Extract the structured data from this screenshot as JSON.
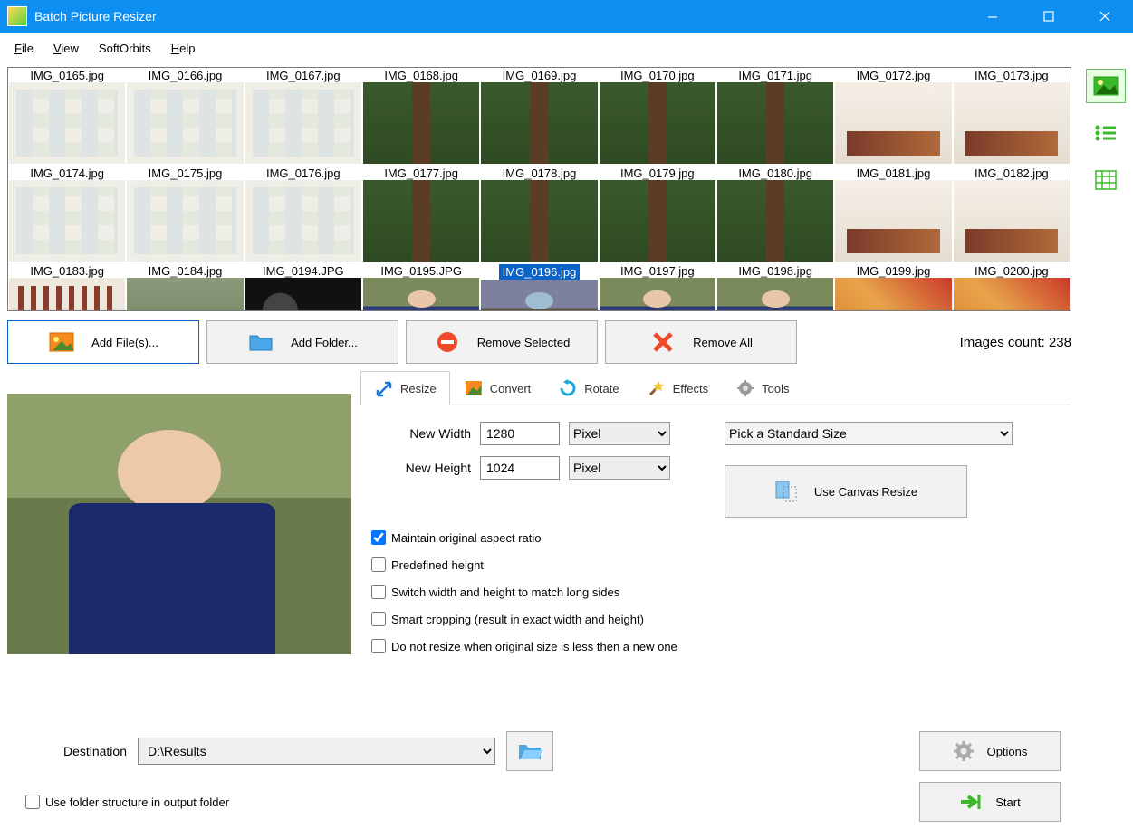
{
  "app": {
    "title": "Batch Picture Resizer"
  },
  "menu": {
    "file": "File",
    "view": "View",
    "softorbits": "SoftOrbits",
    "help": "Help"
  },
  "thumbs": [
    {
      "fn": "IMG_0165.jpg",
      "cls": "t-board"
    },
    {
      "fn": "IMG_0166.jpg",
      "cls": "t-board"
    },
    {
      "fn": "IMG_0167.jpg",
      "cls": "t-board"
    },
    {
      "fn": "IMG_0168.jpg",
      "cls": "t-tree"
    },
    {
      "fn": "IMG_0169.jpg",
      "cls": "t-tree"
    },
    {
      "fn": "IMG_0170.jpg",
      "cls": "t-tree"
    },
    {
      "fn": "IMG_0171.jpg",
      "cls": "t-tree"
    },
    {
      "fn": "IMG_0172.jpg",
      "cls": "t-room"
    },
    {
      "fn": "IMG_0173.jpg",
      "cls": "t-room"
    },
    {
      "fn": "IMG_0174.jpg",
      "cls": "t-board"
    },
    {
      "fn": "IMG_0175.jpg",
      "cls": "t-board"
    },
    {
      "fn": "IMG_0176.jpg",
      "cls": "t-board"
    },
    {
      "fn": "IMG_0177.jpg",
      "cls": "t-tree"
    },
    {
      "fn": "IMG_0178.jpg",
      "cls": "t-tree"
    },
    {
      "fn": "IMG_0179.jpg",
      "cls": "t-tree"
    },
    {
      "fn": "IMG_0180.jpg",
      "cls": "t-tree"
    },
    {
      "fn": "IMG_0181.jpg",
      "cls": "t-room"
    },
    {
      "fn": "IMG_0182.jpg",
      "cls": "t-room"
    },
    {
      "fn": "IMG_0183.jpg",
      "cls": "t-conf"
    },
    {
      "fn": "IMG_0184.jpg",
      "cls": "t-people"
    },
    {
      "fn": "IMG_0194.JPG",
      "cls": "t-dash"
    },
    {
      "fn": "IMG_0195.JPG",
      "cls": "t-woman"
    },
    {
      "fn": "IMG_0196.jpg",
      "cls": "t-woman",
      "sel": true
    },
    {
      "fn": "IMG_0197.jpg",
      "cls": "t-woman"
    },
    {
      "fn": "IMG_0198.jpg",
      "cls": "t-woman"
    },
    {
      "fn": "IMG_0199.jpg",
      "cls": "t-party"
    },
    {
      "fn": "IMG_0200.jpg",
      "cls": "t-party"
    }
  ],
  "buttons": {
    "add_files": "Add File(s)...",
    "add_folder": "Add Folder...",
    "remove_selected": "Remove Selected",
    "remove_all": "Remove All",
    "canvas": "Use Canvas Resize",
    "options": "Options",
    "start": "Start"
  },
  "count_label": "Images count: 238",
  "tabs": {
    "resize": "Resize",
    "convert": "Convert",
    "rotate": "Rotate",
    "effects": "Effects",
    "tools": "Tools"
  },
  "resize": {
    "new_width_label": "New Width",
    "new_width": "1280",
    "width_unit": "Pixel",
    "new_height_label": "New Height",
    "new_height": "1024",
    "height_unit": "Pixel",
    "standard_placeholder": "Pick a Standard Size",
    "chk_aspect": "Maintain original aspect ratio",
    "chk_predef": "Predefined height",
    "chk_switch": "Switch width and height to match long sides",
    "chk_smart": "Smart cropping (result in exact width and height)",
    "chk_noup": "Do not resize when original size is less then a new one"
  },
  "dest": {
    "label": "Destination",
    "value": "D:\\Results"
  },
  "use_folder": "Use folder structure in output folder"
}
